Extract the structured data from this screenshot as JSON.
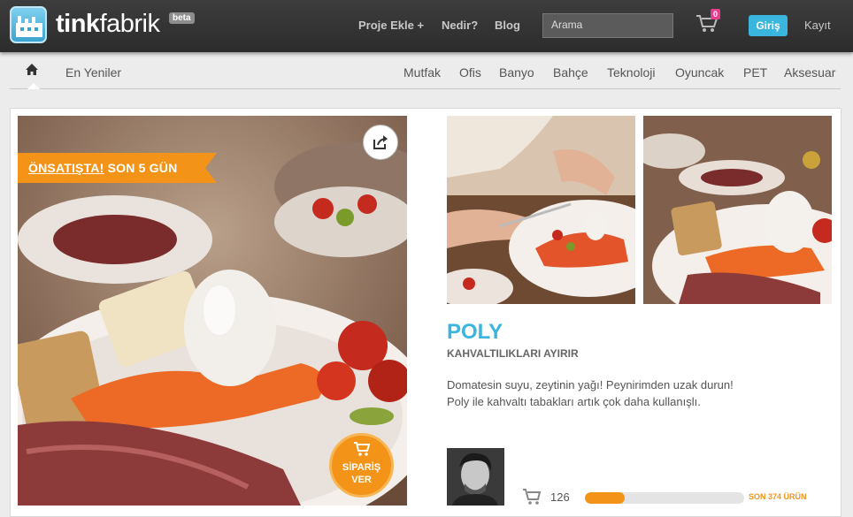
{
  "header": {
    "logo_bold": "tink",
    "logo_light": "fabrik",
    "beta_badge": "beta",
    "nav": [
      {
        "label": "Proje Ekle +"
      },
      {
        "label": "Nedir?"
      },
      {
        "label": "Blog"
      }
    ],
    "search_placeholder": "Arama",
    "cart_count": "0",
    "login_label": "Giriş",
    "register_label": "Kayıt"
  },
  "categories": {
    "home_icon": "home-icon",
    "latest": "En Yeniler",
    "items": [
      "Mutfak",
      "Ofis",
      "Banyo",
      "Bahçe",
      "Teknoloji",
      "Oyuncak",
      "PET",
      "Aksesuar"
    ]
  },
  "product": {
    "presale_label": "ÖNSATIŞTA!",
    "days_left_label": "SON 5 GÜN",
    "order_line1": "SİPARİŞ",
    "order_line2": "VER",
    "title": "POLY",
    "subtitle": "KAHVALTILIKLARI AYIRIR",
    "description_line1": "Domatesin suyu, zeytinin yağı! Peynirimden uzak durun!",
    "description_line2": "Poly ile kahvaltı tabakları artık çok daha kullanışlı.",
    "order_count": "126",
    "remaining_label": "SON 374 ÜRÜN",
    "progress_fraction": 0.25
  },
  "colors": {
    "accent_blue": "#3ab5dd",
    "accent_orange": "#f39419",
    "badge_pink": "#e63d8e"
  }
}
